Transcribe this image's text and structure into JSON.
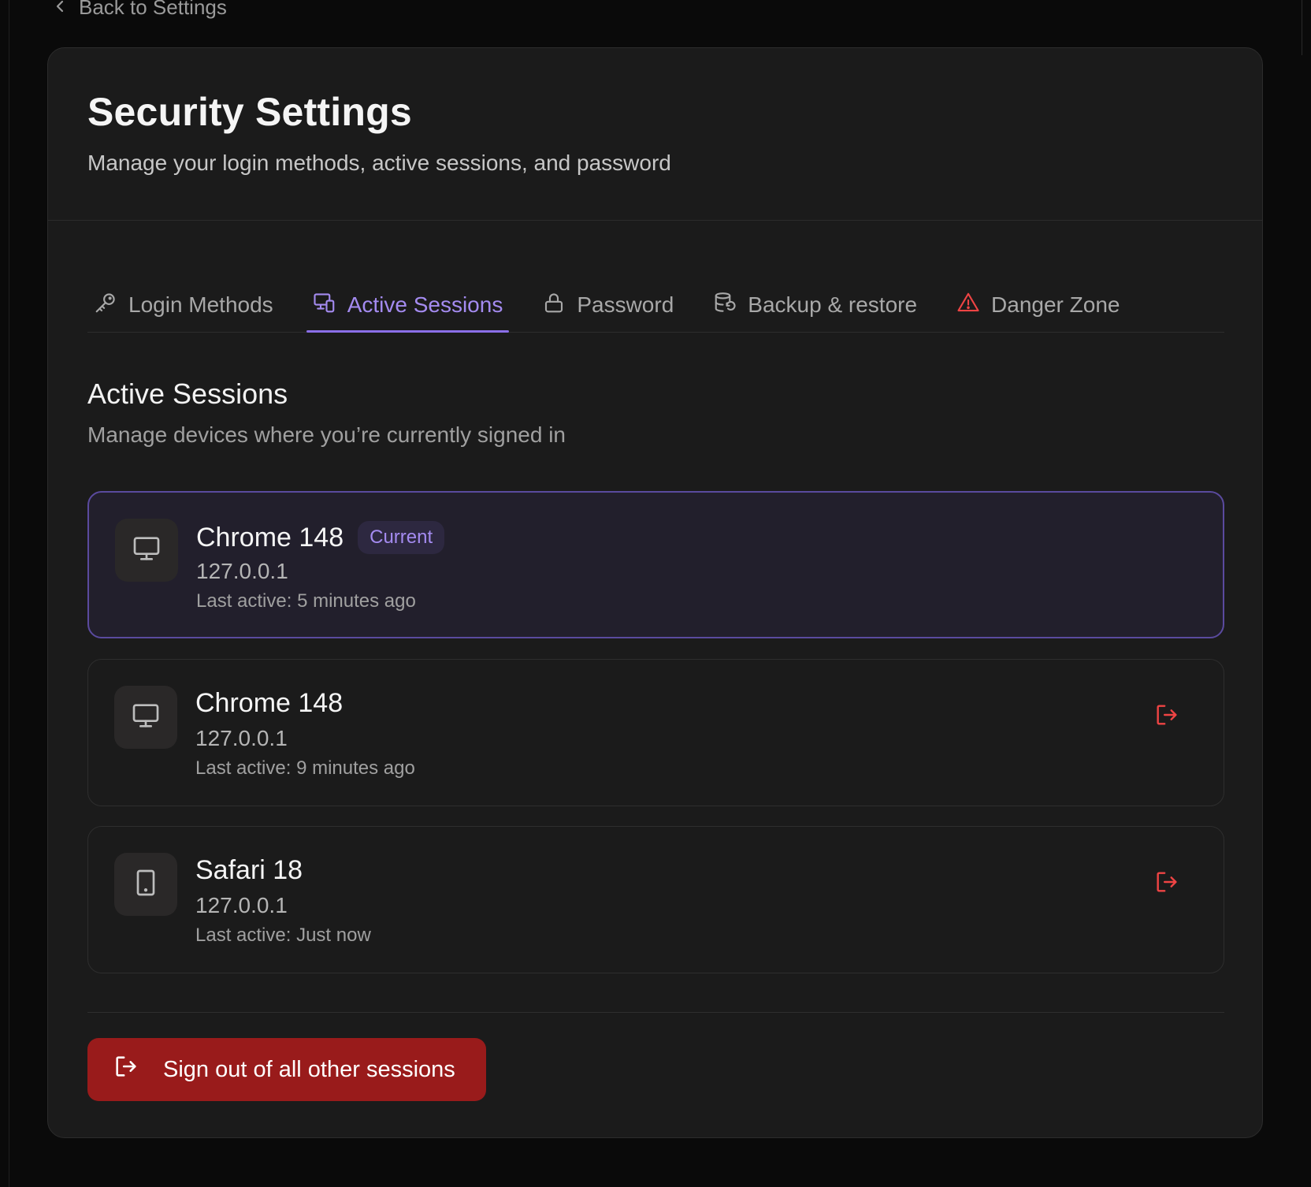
{
  "nav": {
    "back_label": "Back to Settings"
  },
  "header": {
    "title": "Security Settings",
    "subtitle": "Manage your login methods, active sessions, and password"
  },
  "tabs": [
    {
      "label": "Login Methods",
      "icon": "key-icon",
      "active": false
    },
    {
      "label": "Active Sessions",
      "icon": "devices-icon",
      "active": true
    },
    {
      "label": "Password",
      "icon": "lock-icon",
      "active": false
    },
    {
      "label": "Backup & restore",
      "icon": "database-restore-icon",
      "active": false
    },
    {
      "label": "Danger Zone",
      "icon": "warning-triangle-icon",
      "active": false
    }
  ],
  "section": {
    "title": "Active Sessions",
    "subtitle": "Manage devices where you’re currently signed in"
  },
  "sessions": [
    {
      "name": "Chrome 148",
      "badge": "Current",
      "ip": "127.0.0.1",
      "last_active": "Last active: 5 minutes ago",
      "device_icon": "monitor-icon",
      "current": true
    },
    {
      "name": "Chrome 148",
      "ip": "127.0.0.1",
      "last_active": "Last active: 9 minutes ago",
      "device_icon": "monitor-icon",
      "current": false
    },
    {
      "name": "Safari 18",
      "ip": "127.0.0.1",
      "last_active": "Last active: Just now",
      "device_icon": "tablet-icon",
      "current": false
    }
  ],
  "actions": {
    "sign_out_all_label": "Sign out of all other sessions"
  },
  "colors": {
    "accent": "#a48bf0",
    "danger": "#991b1b",
    "danger_icon": "#ef4444",
    "background": "#0a0a0a",
    "card": "#1b1b1b"
  }
}
